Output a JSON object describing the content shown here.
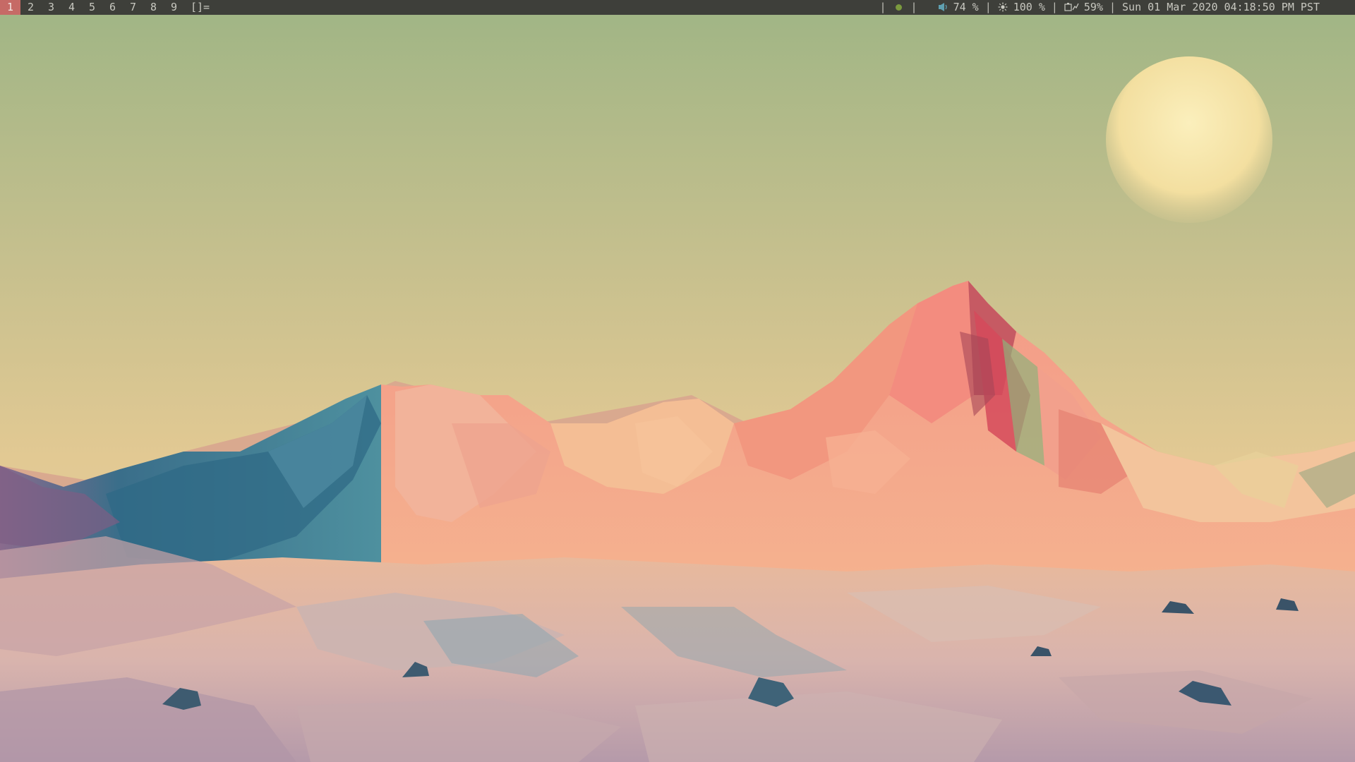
{
  "bar": {
    "tags": [
      "1",
      "2",
      "3",
      "4",
      "5",
      "6",
      "7",
      "8",
      "9"
    ],
    "selected_tag": "1",
    "layout_symbol": "[]=",
    "separator": "|",
    "volume_icon": "speaker-icon",
    "volume": "74 %",
    "brightness_icon": "sun-icon",
    "brightness": "100 %",
    "battery_icon": "battery-charging-icon",
    "battery": "59%",
    "network_icon": "network-status-dot-icon",
    "datetime": "Sun 01 Mar 2020 04:18:50 PM PST"
  },
  "colors": {
    "bar_background": "#3e3f3a",
    "bar_text": "#c8c8c0",
    "selected_tag_background": "#c66a66",
    "network_dot": "#7b9a3e",
    "volume_icon": "#5fa0b0"
  },
  "wallpaper": {
    "description_icon": "low-poly-mountain-wallpaper"
  }
}
